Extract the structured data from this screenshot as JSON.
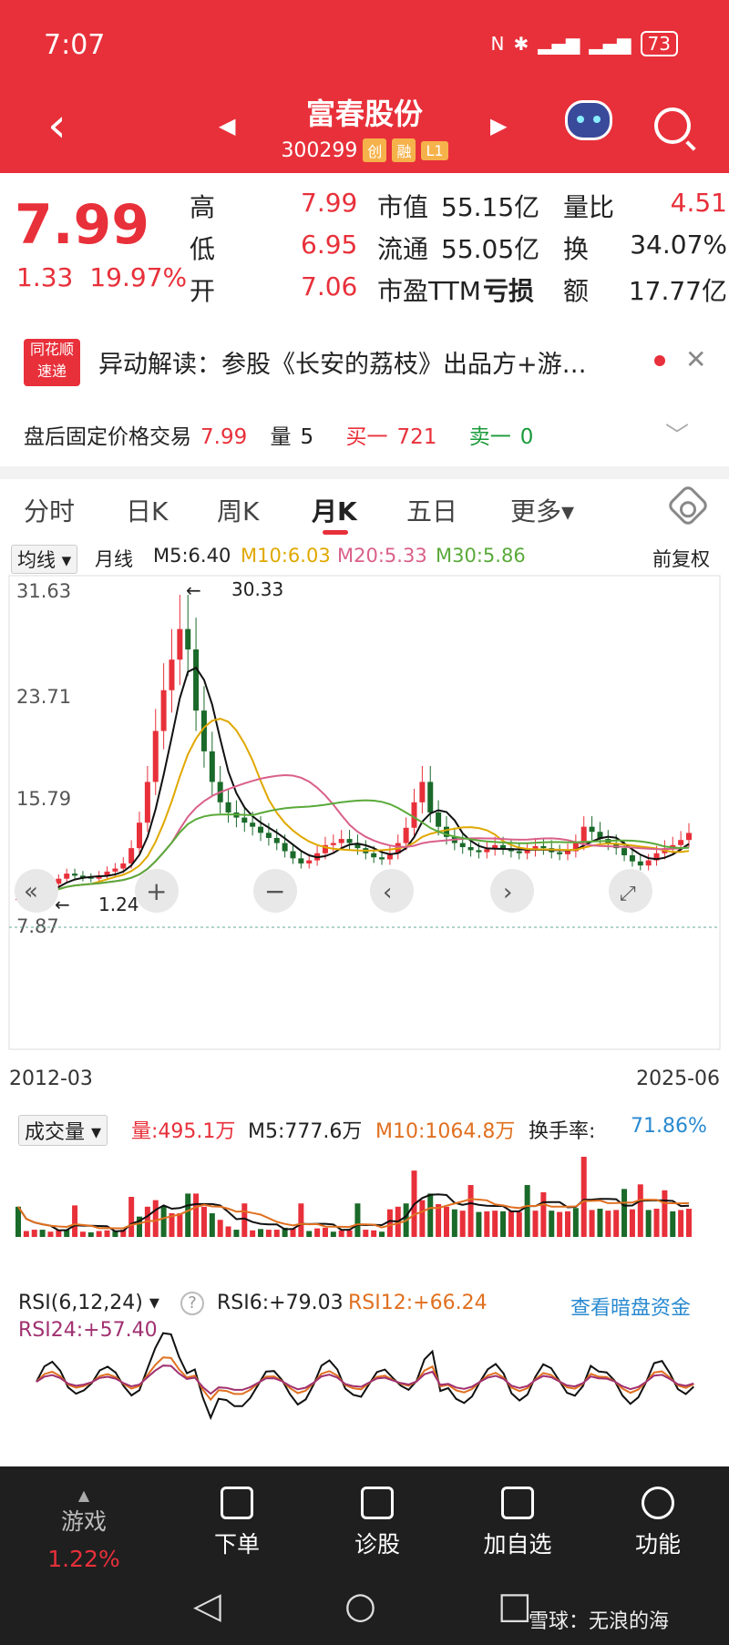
{
  "status_bar": {
    "time": "7:07",
    "battery": "73"
  },
  "header": {
    "title": "富春股份",
    "code": "300299",
    "tags": [
      "创",
      "融",
      "L1"
    ]
  },
  "quote": {
    "price": "7.99",
    "change": "1.33",
    "change_pct": "19.97%",
    "rows": [
      {
        "l1": "高",
        "v1": "7.99",
        "l2": "市值",
        "v2": "55.15亿",
        "l3": "量比",
        "v3": "4.51"
      },
      {
        "l1": "低",
        "v1": "6.95",
        "l2": "流通",
        "v2": "55.05亿",
        "l3": "换",
        "v3": "34.07%"
      },
      {
        "l1": "开",
        "v1": "7.06",
        "l2": "市盈TTM",
        "v2": "亏损",
        "l3": "额",
        "v3": "17.77亿"
      }
    ]
  },
  "news": {
    "logo_line1": "同花顺",
    "logo_line2": "速递",
    "text": "异动解读：参股《长安的荔枝》出品方+游…"
  },
  "after_hours": {
    "label": "盘后固定价格交易",
    "price": "7.99",
    "vol_label": "量",
    "vol": "5",
    "buy_label": "买一",
    "buy": "721",
    "sell_label": "卖一",
    "sell": "0"
  },
  "tabs": [
    "分时",
    "日K",
    "周K",
    "月K",
    "五日",
    "更多▾"
  ],
  "active_tab": "月K",
  "ma_legend": {
    "type": "均线 ▾",
    "period": "月线",
    "m5": "M5:6.40",
    "m10": "M10:6.03",
    "m20": "M20:5.33",
    "m30": "M30:5.86",
    "adj": "前复权"
  },
  "kline": {
    "y_ticks": [
      "31.63",
      "23.71",
      "15.79",
      "7.87"
    ],
    "max_label": "30.33",
    "min_label": "1.24",
    "start_date": "2012-03",
    "end_date": "2025-06",
    "colors": {
      "up": "#e8303a",
      "down": "#1a6a2a",
      "m5": "#111111",
      "m10": "#e0a800",
      "m20": "#d9608a",
      "m30": "#5aaa3a"
    }
  },
  "volume": {
    "title": "成交量 ▾",
    "vol": "量:495.1万",
    "m5": "M5:777.6万",
    "m10": "M10:1064.8万",
    "turnover_label": "换手率:",
    "turnover": "71.86%"
  },
  "rsi": {
    "title": "RSI(6,12,24) ▾",
    "help": "?",
    "rsi6": "RSI6:+79.03",
    "rsi12": "RSI12:+66.24",
    "rsi24": "RSI24:+57.40",
    "link": "查看暗盘资金"
  },
  "bottom_nav": [
    {
      "label": "游戏",
      "sub": "1.22%"
    },
    {
      "label": "下单"
    },
    {
      "label": "诊股"
    },
    {
      "label": "加自选"
    },
    {
      "label": "功能"
    }
  ],
  "watermark": "雪球：无浪的海",
  "chart_data": {
    "type": "candlestick",
    "x_range": [
      "2012-03",
      "2025-06"
    ],
    "ylim": [
      1.24,
      31.63
    ],
    "y_ticks": [
      31.63,
      23.71,
      15.79,
      7.87
    ],
    "high_mark": 30.33,
    "low_mark": 1.24,
    "last_close": 7.99,
    "ma": {
      "M5": 6.4,
      "M10": 6.03,
      "M20": 5.33,
      "M30": 5.86
    }
  }
}
